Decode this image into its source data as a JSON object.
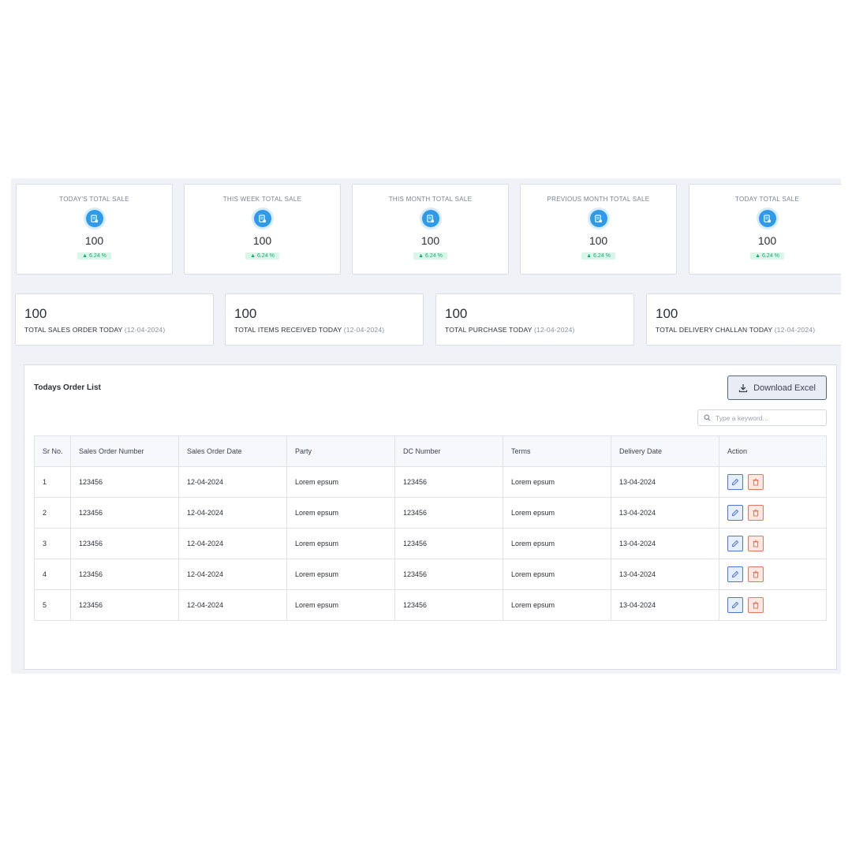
{
  "stats": [
    {
      "title": "TODAY'S TOTAL SALE",
      "value": "100",
      "change": "6.24 %"
    },
    {
      "title": "THIS WEEK TOTAL SALE",
      "value": "100",
      "change": "6.24 %"
    },
    {
      "title": "THIS MONTH TOTAL SALE",
      "value": "100",
      "change": "6.24 %"
    },
    {
      "title": "PREVIOUS MONTH TOTAL SALE",
      "value": "100",
      "change": "6.24 %"
    },
    {
      "title": "TODAY TOTAL SALE",
      "value": "100",
      "change": "6.24 %"
    }
  ],
  "summary": [
    {
      "value": "100",
      "label": "TOTAL SALES ORDER TODAY",
      "date": "(12-04-2024)"
    },
    {
      "value": "100",
      "label": "TOTAL ITEMS RECEIVED TODAY",
      "date": "(12-04-2024)"
    },
    {
      "value": "100",
      "label": "TOTAL PURCHASE TODAY",
      "date": "(12-04-2024)"
    },
    {
      "value": "100",
      "label": "TOTAL DELIVERY CHALLAN TODAY",
      "date": "(12-04-2024)"
    }
  ],
  "orders": {
    "title": "Todays Order List",
    "download_label": "Download Excel",
    "search_placeholder": "Type a keyword...",
    "columns": [
      "Sr No.",
      "Sales Order Number",
      "Sales Order Date",
      "Party",
      "DC Number",
      "Terms",
      "Delivery Date",
      "Action"
    ],
    "rows": [
      [
        "1",
        "123456",
        "12-04-2024",
        "Lorem epsum",
        "123456",
        "Lorem epsum",
        "13-04-2024"
      ],
      [
        "2",
        "123456",
        "12-04-2024",
        "Lorem epsum",
        "123456",
        "Lorem epsum",
        "13-04-2024"
      ],
      [
        "3",
        "123456",
        "12-04-2024",
        "Lorem epsum",
        "123456",
        "Lorem epsum",
        "13-04-2024"
      ],
      [
        "4",
        "123456",
        "12-04-2024",
        "Lorem epsum",
        "123456",
        "Lorem epsum",
        "13-04-2024"
      ],
      [
        "5",
        "123456",
        "12-04-2024",
        "Lorem epsum",
        "123456",
        "Lorem epsum",
        "13-04-2024"
      ]
    ]
  },
  "icons": {
    "stat": "document-icon",
    "download": "download-icon",
    "search": "search-icon",
    "edit": "edit-icon",
    "delete": "trash-icon"
  },
  "colors": {
    "accent": "#2f9be8",
    "positive": "#1aa971",
    "edit": "#4b74d8",
    "delete": "#e5775d"
  }
}
